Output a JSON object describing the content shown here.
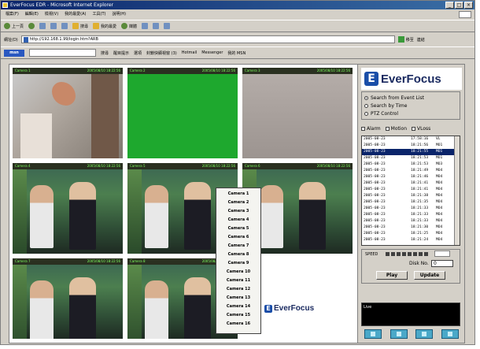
{
  "window": {
    "title": "EverFocus EDR - Microsoft Internet Explorer",
    "controls": [
      "_",
      "□",
      "×"
    ]
  },
  "menubar": {
    "items": [
      "檔案(F)",
      "編輯(E)",
      "檢視(V)",
      "我的最愛(A)",
      "工具(T)",
      "說明(H)"
    ]
  },
  "toolbar": {
    "back": "上一頁",
    "search": "搜尋",
    "favorites": "我的最愛",
    "media": "媒體"
  },
  "address": {
    "label": "網址(D)",
    "value": "http://192.168.1.99/login.htm?ARB",
    "go": "移至",
    "links": "連結"
  },
  "links_toolbar": {
    "search_brand": "msn",
    "buttons": [
      "搜尋",
      "醒目提示",
      "選項",
      "封鎖快顯視窗 (3)",
      "Hotmail",
      "Messenger",
      "我的 MSN"
    ]
  },
  "grid": {
    "cameras": [
      {
        "title": "Camera 1",
        "time": "2005/08/10 18:22:56",
        "scene": "office"
      },
      {
        "title": "Camera 2",
        "time": "2005/08/10 18:22:56",
        "scene": "green"
      },
      {
        "title": "Camera 3",
        "time": "2005/08/10 18:22:56",
        "scene": "gray"
      },
      {
        "title": "Camera 4",
        "time": "2005/08/10 18:22:56",
        "scene": "people"
      },
      {
        "title": "Camera 5",
        "time": "2005/08/10 18:22:56",
        "scene": "people"
      },
      {
        "title": "Camera 6",
        "time": "2005/08/10 18:22:56",
        "scene": "people"
      },
      {
        "title": "Camera 7",
        "time": "2005/08/10 18:22:56",
        "scene": "people"
      },
      {
        "title": "Camera 8",
        "time": "2005/08/10 18:22:56",
        "scene": "people"
      }
    ],
    "center_logo": "EverFocus"
  },
  "camera_menu": {
    "items": [
      "Camera 1",
      "Camera 2",
      "Camera 3",
      "Camera 4",
      "Camera 5",
      "Camera 6",
      "Camera 7",
      "Camera 8",
      "Camera 9",
      "Camera 10",
      "Camera 11",
      "Camera 12",
      "Camera 13",
      "Camera 14",
      "Camera 15",
      "Camera 16"
    ]
  },
  "panel": {
    "brand": "EverFocus",
    "brand_mark": "E",
    "modes": [
      {
        "label": "Search from Event List",
        "selected": true
      },
      {
        "label": "Search by Time",
        "selected": false
      },
      {
        "label": "PTZ Control",
        "selected": false
      }
    ],
    "filters": [
      "Alarm",
      "Motion",
      "VLoss"
    ],
    "events": [
      {
        "date": "2005-08-23",
        "time": "17:58:16",
        "type": "VL"
      },
      {
        "date": "2005-08-23",
        "time": "18:21:56",
        "type": "MO1"
      },
      {
        "date": "2005-08-23",
        "time": "18:21:55",
        "type": "MO1",
        "selected": true
      },
      {
        "date": "2005-08-23",
        "time": "18:21:53",
        "type": "MO1"
      },
      {
        "date": "2005-08-23",
        "time": "18:21:53",
        "type": "MO3"
      },
      {
        "date": "2005-08-23",
        "time": "18:21:49",
        "type": "MO4"
      },
      {
        "date": "2005-08-23",
        "time": "18:21:46",
        "type": "MO4"
      },
      {
        "date": "2005-08-23",
        "time": "18:21:41",
        "type": "MO4"
      },
      {
        "date": "2005-08-23",
        "time": "18:21:41",
        "type": "MO4"
      },
      {
        "date": "2005-08-23",
        "time": "18:21:38",
        "type": "MO4"
      },
      {
        "date": "2005-08-23",
        "time": "18:21:35",
        "type": "MO4"
      },
      {
        "date": "2005-08-23",
        "time": "18:21:33",
        "type": "MO4"
      },
      {
        "date": "2005-08-23",
        "time": "18:21:33",
        "type": "MO4"
      },
      {
        "date": "2005-08-23",
        "time": "18:21:33",
        "type": "MO4"
      },
      {
        "date": "2005-08-23",
        "time": "18:21:30",
        "type": "MO4"
      },
      {
        "date": "2005-08-23",
        "time": "18:21:25",
        "type": "MO4"
      },
      {
        "date": "2005-08-23",
        "time": "18:21:24",
        "type": "MO4"
      }
    ],
    "speed_label": "SPEED",
    "disk_label": "Disk No.",
    "disk_value": "0",
    "play": "Play",
    "update": "Update",
    "live_label": "Live"
  },
  "status": {
    "text": ""
  }
}
